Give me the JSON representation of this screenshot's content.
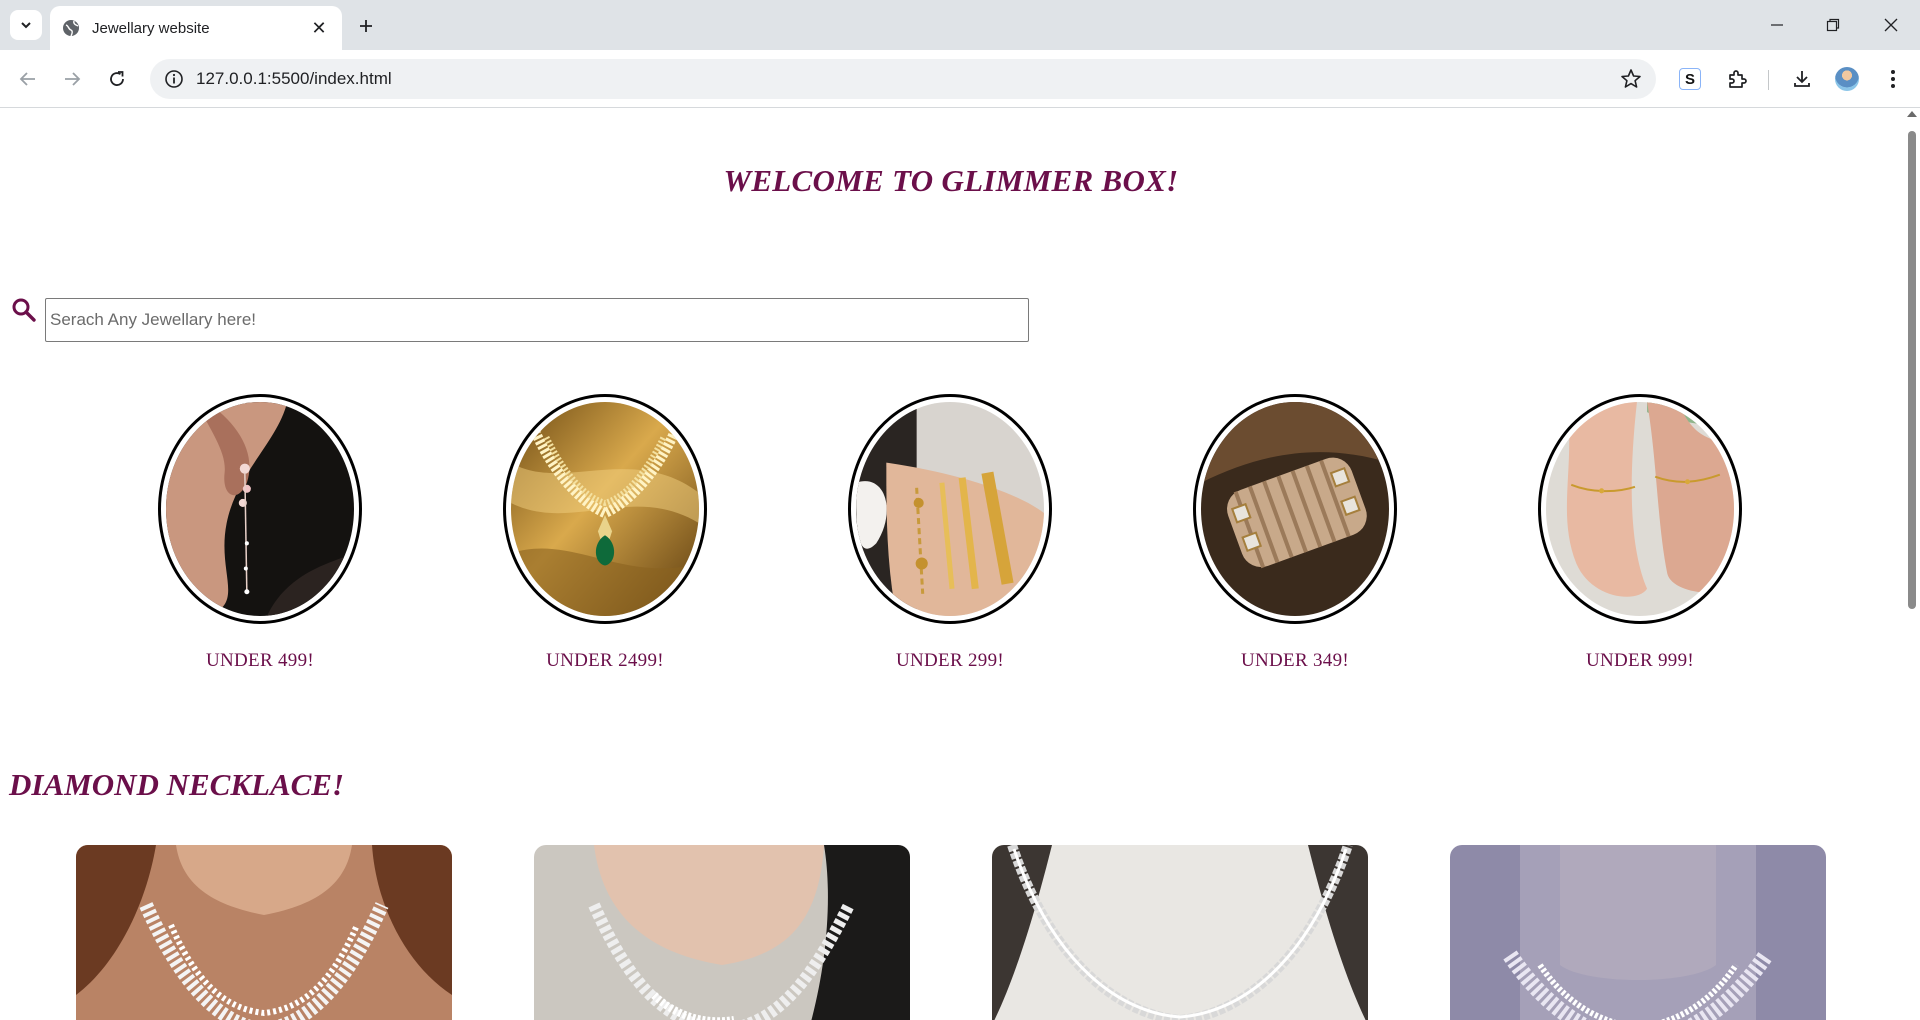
{
  "browser": {
    "tab_title": "Jewellary website",
    "url": "127.0.0.1:5500/index.html",
    "extension_letter": "S"
  },
  "page": {
    "welcome": "WELCOME TO GLIMMER BOX!",
    "search": {
      "placeholder": "Serach Any Jewellary here!",
      "value": ""
    },
    "categories": [
      {
        "label": "UNDER 499!",
        "image": "earring"
      },
      {
        "label": "UNDER 2499!",
        "image": "gold-necklace"
      },
      {
        "label": "UNDER 299!",
        "image": "bracelets"
      },
      {
        "label": "UNDER 349!",
        "image": "bangles"
      },
      {
        "label": "UNDER 999!",
        "image": "anklets"
      }
    ],
    "section_title": "DIAMOND NECKLACE!",
    "products": [
      {
        "image": "diamond-necklace-1"
      },
      {
        "image": "diamond-necklace-2"
      },
      {
        "image": "diamond-necklace-3"
      },
      {
        "image": "diamond-necklace-4"
      }
    ]
  },
  "colors": {
    "brand": "#6b0f4a",
    "chrome_bg": "#dfe3e7",
    "omnibox_bg": "#eff1f3"
  }
}
